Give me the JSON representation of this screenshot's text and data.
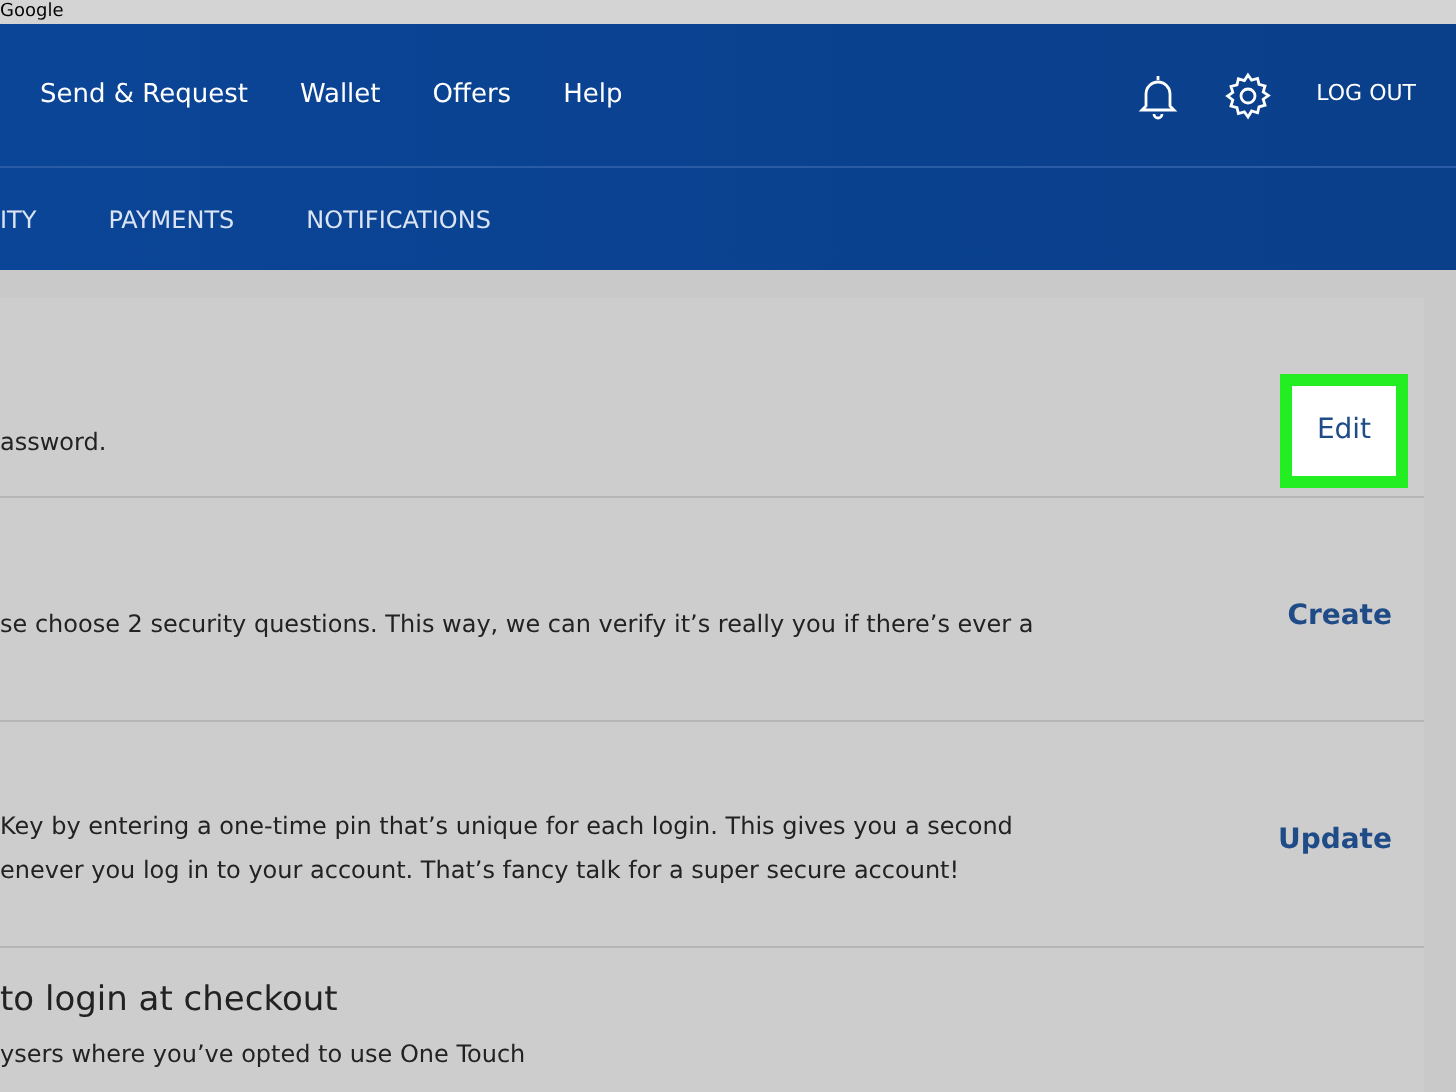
{
  "browser_bar": {
    "title": "Google"
  },
  "nav": {
    "items": [
      {
        "label": "Send & Request"
      },
      {
        "label": "Wallet"
      },
      {
        "label": "Offers"
      },
      {
        "label": "Help"
      }
    ],
    "logout": "LOG OUT"
  },
  "tabs": [
    {
      "label": "ITY",
      "selected": false
    },
    {
      "label": "PAYMENTS",
      "selected": false
    },
    {
      "label": "NOTIFICATIONS",
      "selected": false
    }
  ],
  "rows": [
    {
      "kind": "text",
      "lines": [
        "assword."
      ],
      "action": {
        "label": "Edit",
        "highlighted": true
      }
    },
    {
      "kind": "text",
      "lines": [
        "se choose 2 security questions. This way, we can verify it’s really you if there’s ever a"
      ],
      "action": {
        "label": "Create",
        "highlighted": false
      }
    },
    {
      "kind": "text",
      "lines": [
        "Key by entering a one-time pin that’s unique for each login. This gives you a second",
        "enever you log in to your account. That’s fancy talk for a super secure account!"
      ],
      "action": {
        "label": "Update",
        "highlighted": false
      }
    },
    {
      "kind": "heading",
      "title": "to login at checkout",
      "lines": [
        "ysers where you’ve opted to use One Touch"
      ]
    }
  ]
}
